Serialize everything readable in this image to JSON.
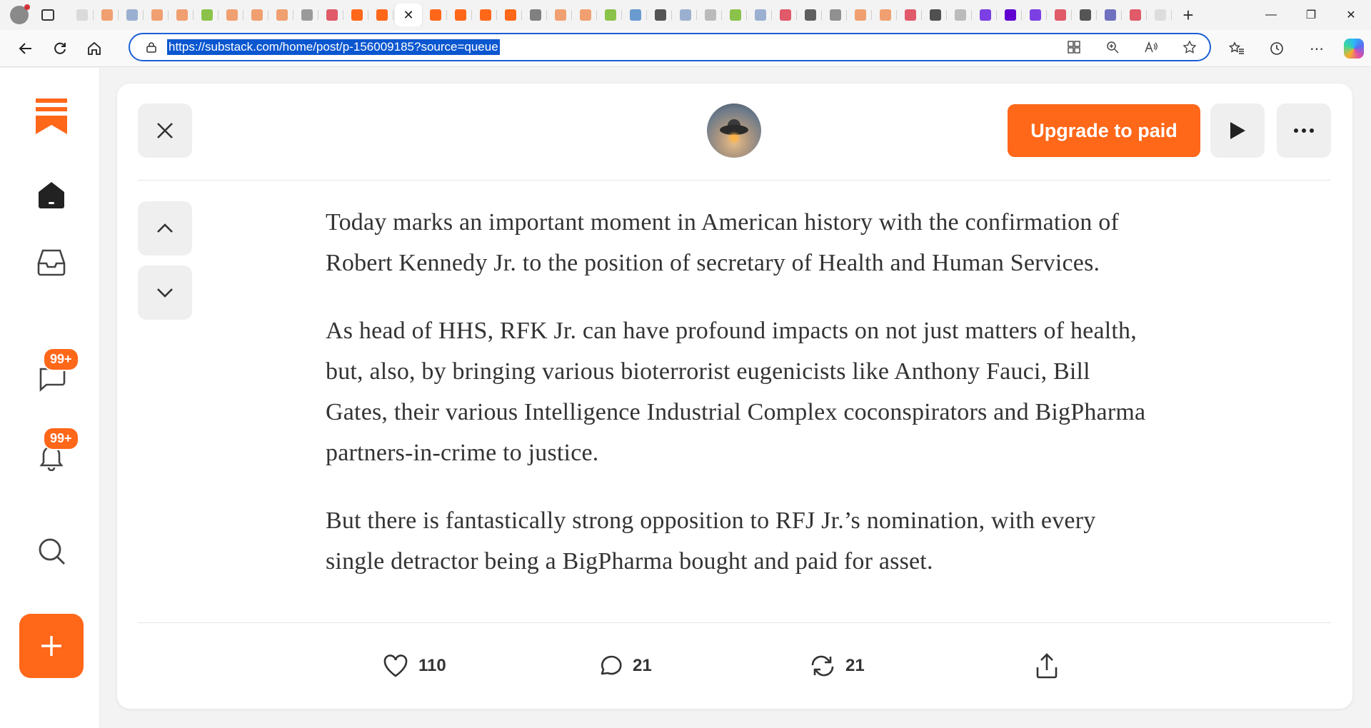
{
  "browser": {
    "url": "https://substack.com/home/post/p-156009185?source=queue",
    "tab_favicon_colors": [
      "#dadada",
      "#f0a070",
      "#9bb0d0",
      "#f0a070",
      "#f0a070",
      "#8bc34a",
      "#f0a070",
      "#f0a070",
      "#f0a070",
      "#9a9a9a",
      "#e05a6a",
      "#ff6719",
      "#ff6719",
      "#ff6719",
      "#ff6719",
      "#ff6719",
      "#ff6719",
      "#808080",
      "#f0a070",
      "#f0a070",
      "#8bc34a",
      "#6a9ad0",
      "#555555",
      "#9bb0d0",
      "#bbbbbb",
      "#8bc34a",
      "#9bb0d0",
      "#e05a6a",
      "#606060",
      "#909090",
      "#f0a070",
      "#f0a070",
      "#e05a6a",
      "#505050",
      "#bbbbbb",
      "#7b3fe4",
      "#6001d2",
      "#7b3fe4",
      "#e05a6a",
      "#555555",
      "#7070c0",
      "#e05a6a",
      "#dddddd"
    ]
  },
  "sidebar": {
    "brand_color": "#ff6719",
    "chat_badge": "99+",
    "activity_badge": "99+"
  },
  "post": {
    "upgrade_label": "Upgrade to paid",
    "paragraphs": [
      "Today marks an important moment in American history with the confirmation of Robert Kennedy Jr. to the position of secretary of Health and Human Services.",
      "As head of HHS, RFK Jr. can have profound impacts on not just matters of health, but, also, by bringing various bioterrorist eugenicists like Anthony Fauci, Bill Gates, their various Intelligence Industrial Complex coconspirators and BigPharma partners-in-crime to justice.",
      "But there is fantastically strong opposition to RFJ Jr.’s nomination, with every single detractor being a BigPharma bought and paid for asset."
    ],
    "likes": "110",
    "comments": "21",
    "restacks": "21"
  }
}
